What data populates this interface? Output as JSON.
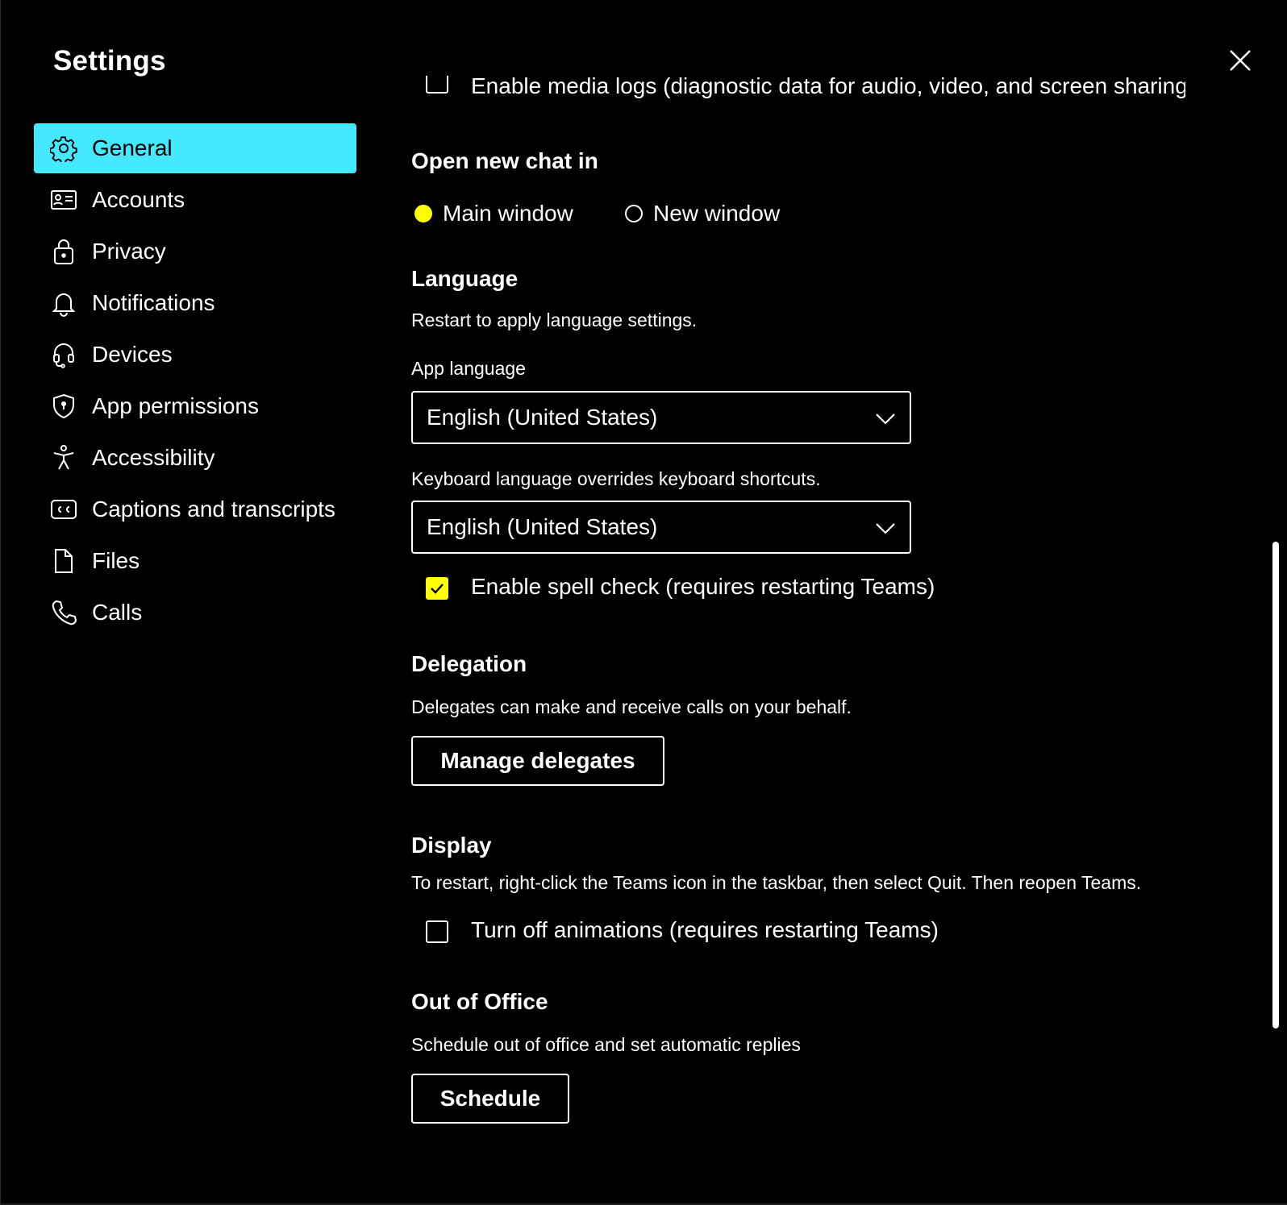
{
  "dialog": {
    "title": "Settings",
    "close_icon": "close-icon"
  },
  "sidebar": {
    "items": [
      {
        "label": "General",
        "icon": "gear-icon",
        "active": true
      },
      {
        "label": "Accounts",
        "icon": "id-card-icon"
      },
      {
        "label": "Privacy",
        "icon": "lock-icon"
      },
      {
        "label": "Notifications",
        "icon": "bell-icon"
      },
      {
        "label": "Devices",
        "icon": "headset-icon"
      },
      {
        "label": "App permissions",
        "icon": "shield-icon"
      },
      {
        "label": "Accessibility",
        "icon": "accessibility-icon"
      },
      {
        "label": "Captions and transcripts",
        "icon": "cc-icon"
      },
      {
        "label": "Files",
        "icon": "file-icon"
      },
      {
        "label": "Calls",
        "icon": "phone-icon"
      }
    ]
  },
  "main": {
    "cut_off_option": "Enable media logs (diagnostic data for audio, video, and screen sharing)",
    "open_chat": {
      "heading": "Open new chat in",
      "options": [
        {
          "label": "Main window",
          "selected": true
        },
        {
          "label": "New window",
          "selected": false
        }
      ]
    },
    "language": {
      "heading": "Language",
      "description": "Restart to apply language settings.",
      "app_language_label": "App language",
      "app_language_value": "English (United States)",
      "keyboard_description": "Keyboard language overrides keyboard shortcuts.",
      "keyboard_language_value": "English (United States)",
      "spell_check_label": "Enable spell check (requires restarting Teams)",
      "spell_check_checked": true
    },
    "delegation": {
      "heading": "Delegation",
      "description": "Delegates can make and receive calls on your behalf.",
      "button_label": "Manage delegates"
    },
    "display": {
      "heading": "Display",
      "description": "To restart, right-click the Teams icon in the taskbar, then select Quit. Then reopen Teams.",
      "animations_label": "Turn off animations (requires restarting Teams)",
      "animations_checked": false
    },
    "out_of_office": {
      "heading": "Out of Office",
      "description": "Schedule out of office and set automatic replies",
      "button_label": "Schedule"
    }
  },
  "colors": {
    "accent": "#44e8ff",
    "selected": "#ffff00",
    "background": "#000000",
    "text": "#ffffff"
  }
}
